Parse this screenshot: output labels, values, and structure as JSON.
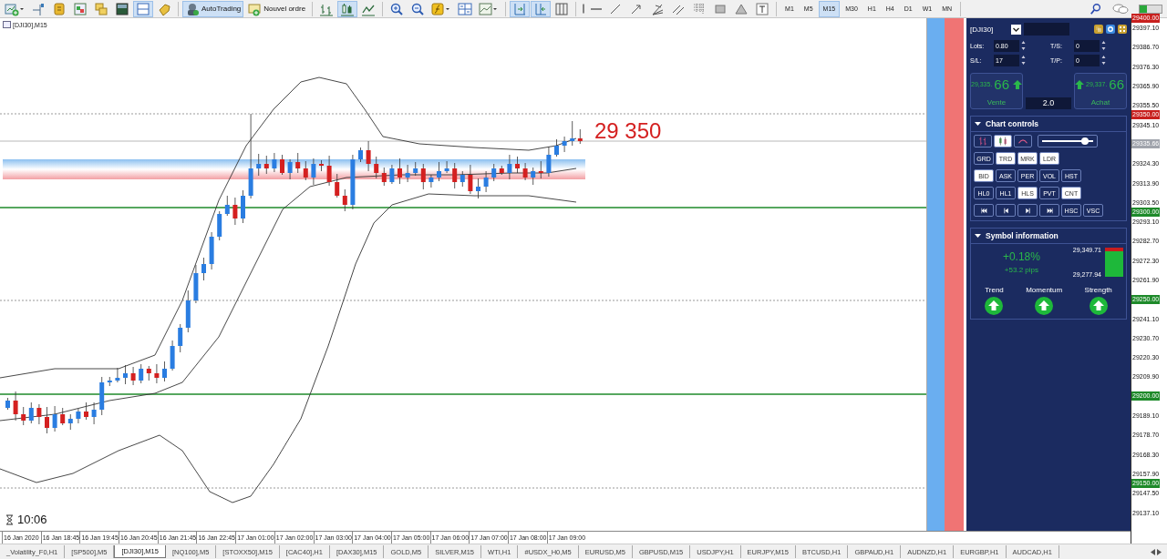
{
  "toolbar": {
    "buttons": [
      {
        "kind": "new-chart",
        "pressed": false
      },
      {
        "kind": "crosshair",
        "pressed": false
      },
      {
        "kind": "coins",
        "pressed": false
      },
      {
        "kind": "navigator",
        "pressed": false
      },
      {
        "kind": "folders",
        "pressed": false
      },
      {
        "kind": "terminal",
        "pressed": false
      },
      {
        "kind": "tester",
        "pressed": true
      },
      {
        "kind": "tag",
        "pressed": false
      },
      {
        "kind": "autotrading",
        "label": "AutoTrading",
        "pressed": true
      },
      {
        "kind": "new-order",
        "label": "Nouvel ordre",
        "pressed": false
      },
      {
        "kind": "bars",
        "pressed": false
      },
      {
        "kind": "candles",
        "pressed": true
      },
      {
        "kind": "line",
        "pressed": false
      },
      {
        "kind": "zoom-in",
        "pressed": false
      },
      {
        "kind": "zoom-out",
        "pressed": false
      },
      {
        "kind": "indicators",
        "pressed": false
      },
      {
        "kind": "tile",
        "pressed": false
      },
      {
        "kind": "template",
        "pressed": false
      },
      {
        "kind": "shift",
        "pressed": true
      },
      {
        "kind": "autoscroll",
        "pressed": true
      },
      {
        "kind": "periods",
        "pressed": false
      },
      {
        "kind": "vline",
        "pressed": false
      },
      {
        "kind": "hline",
        "pressed": false
      },
      {
        "kind": "trendline",
        "pressed": false
      },
      {
        "kind": "arrow",
        "pressed": false
      },
      {
        "kind": "fan",
        "pressed": false
      },
      {
        "kind": "channel",
        "pressed": false
      },
      {
        "kind": "grid",
        "pressed": false
      },
      {
        "kind": "rect",
        "pressed": false
      },
      {
        "kind": "triangle",
        "pressed": false
      },
      {
        "kind": "textbox",
        "pressed": false
      }
    ],
    "timeframes": [
      {
        "label": "M1",
        "selected": false
      },
      {
        "label": "M5",
        "selected": false
      },
      {
        "label": "M15",
        "selected": true
      },
      {
        "label": "M30",
        "selected": false
      },
      {
        "label": "H1",
        "selected": false
      },
      {
        "label": "H4",
        "selected": false
      },
      {
        "label": "D1",
        "selected": false
      },
      {
        "label": "W1",
        "selected": false
      },
      {
        "label": "MN",
        "selected": false
      }
    ]
  },
  "chart": {
    "title": "[DJI30],M15",
    "level_label": "29 350",
    "timer": "10:06",
    "time_labels": [
      "16 Jan 2020",
      "16 Jan 18:45",
      "16 Jan 19:45",
      "16 Jan 20:45",
      "16 Jan 21:45",
      "16 Jan 22:45",
      "17 Jan 01:00",
      "17 Jan 02:00",
      "17 Jan 03:00",
      "17 Jan 04:00",
      "17 Jan 05:00",
      "17 Jan 06:00",
      "17 Jan 07:00",
      "17 Jan 08:00",
      "17 Jan 09:00"
    ]
  },
  "price_axis": [
    {
      "kind": "overlay-tag",
      "label": "29400.00",
      "color": "#c8201e"
    },
    {
      "kind": "tick",
      "label": "29397.10"
    },
    {
      "kind": "tick",
      "label": "29386.70"
    },
    {
      "kind": "tick",
      "label": "29376.30"
    },
    {
      "kind": "tick",
      "label": "29365.90"
    },
    {
      "kind": "tick",
      "label": "29355.50"
    },
    {
      "kind": "overlay-tag",
      "label": "29350.00",
      "color": "#c8201e"
    },
    {
      "kind": "tick",
      "label": "29345.10"
    },
    {
      "kind": "tag",
      "label": "29335.66",
      "color": "#a0a4ac"
    },
    {
      "kind": "tick",
      "label": "29324.30"
    },
    {
      "kind": "tick",
      "label": "29313.90"
    },
    {
      "kind": "tick",
      "label": "29303.50"
    },
    {
      "kind": "overlay-tag",
      "label": "29300.00",
      "color": "#1e8a2a"
    },
    {
      "kind": "tick",
      "label": "29293.10"
    },
    {
      "kind": "tick",
      "label": "29282.70"
    },
    {
      "kind": "tick",
      "label": "29272.30"
    },
    {
      "kind": "tick",
      "label": "29261.90"
    },
    {
      "kind": "tag",
      "label": "29250.00",
      "color": "#1e8a2a"
    },
    {
      "kind": "tick",
      "label": "29241.10"
    },
    {
      "kind": "tick",
      "label": "29230.70"
    },
    {
      "kind": "tick",
      "label": "29220.30"
    },
    {
      "kind": "tick",
      "label": "29209.90"
    },
    {
      "kind": "tag",
      "label": "29200.00",
      "color": "#1e8a2a"
    },
    {
      "kind": "tick",
      "label": "29189.10"
    },
    {
      "kind": "tick",
      "label": "29178.70"
    },
    {
      "kind": "tick",
      "label": "29168.30"
    },
    {
      "kind": "tick",
      "label": "29157.90"
    },
    {
      "kind": "overlay-tag",
      "label": "29150.00",
      "color": "#1e8a2a"
    },
    {
      "kind": "tick",
      "label": "29147.50"
    },
    {
      "kind": "tick",
      "label": "29137.10"
    }
  ],
  "panel": {
    "symbol": "[DJI30]",
    "fields": [
      {
        "label": "Lots:",
        "value": "0.80"
      },
      {
        "label": "T/S:",
        "value": "0"
      },
      {
        "label": "S/L:",
        "value": "17"
      },
      {
        "label": "T/P:",
        "value": "0"
      }
    ],
    "sell": {
      "price": "29,335.",
      "pips": "66",
      "label": "Vente"
    },
    "volume": "2.0",
    "buy": {
      "price": "29,337.",
      "pips": "66",
      "label": "Achat"
    },
    "chart_controls": {
      "title": "Chart controls",
      "expanded": true,
      "style_buttons": [
        {
          "kind": "bars",
          "on": false
        },
        {
          "kind": "candles",
          "on": true
        },
        {
          "kind": "line",
          "on": false
        }
      ],
      "slider": {
        "level": 0.8
      },
      "rows": [
        [
          {
            "kind": "text",
            "label": "GRD",
            "on": false
          },
          {
            "kind": "text",
            "label": "TRD",
            "on": true
          },
          {
            "kind": "text",
            "label": "MRK",
            "on": true
          },
          {
            "kind": "text",
            "label": "LDR",
            "on": true
          }
        ],
        [
          {
            "kind": "text",
            "label": "BID",
            "on": true
          },
          {
            "kind": "text",
            "label": "ASK",
            "on": false
          },
          {
            "kind": "text",
            "label": "PER",
            "on": false
          },
          {
            "kind": "text",
            "label": "VOL",
            "on": false
          },
          {
            "kind": "text",
            "label": "HST",
            "on": false
          }
        ],
        [
          {
            "kind": "text",
            "label": "HL0",
            "on": false
          },
          {
            "kind": "text",
            "label": "HL1",
            "on": false
          },
          {
            "kind": "text",
            "label": "HLS",
            "on": true
          },
          {
            "kind": "text",
            "label": "PVT",
            "on": false
          },
          {
            "kind": "text",
            "label": "CNT",
            "on": true
          }
        ],
        [
          {
            "kind": "first",
            "on": false
          },
          {
            "kind": "prev",
            "on": false
          },
          {
            "kind": "next",
            "on": false
          },
          {
            "kind": "last",
            "on": false
          },
          {
            "kind": "text",
            "label": "HSC",
            "on": false
          },
          {
            "kind": "text",
            "label": "VSC",
            "on": false
          }
        ]
      ]
    },
    "symbol_info": {
      "title": "Symbol information",
      "expanded": true,
      "change": "+0.18%",
      "pips": "+53.2 pips",
      "high": "29,349.71",
      "low": "29,277.94",
      "range": {
        "level": 0.88
      },
      "indicators": [
        {
          "label": "Trend",
          "kind": "up"
        },
        {
          "label": "Momentum",
          "kind": "up"
        },
        {
          "label": "Strength",
          "kind": "up"
        }
      ]
    }
  },
  "tabs": [
    {
      "label": "_Volatility_F0,H1",
      "selected": false
    },
    {
      "label": "[SP500],M5",
      "selected": false
    },
    {
      "label": "[DJI30],M15",
      "selected": true
    },
    {
      "label": "[NQ100],M5",
      "selected": false
    },
    {
      "label": "[STOXX50],M15",
      "selected": false
    },
    {
      "label": "[CAC40],H1",
      "selected": false
    },
    {
      "label": "[DAX30],M15",
      "selected": false
    },
    {
      "label": "GOLD,M5",
      "selected": false
    },
    {
      "label": "SILVER,M15",
      "selected": false
    },
    {
      "label": "WTI,H1",
      "selected": false
    },
    {
      "label": "#USDX_H0,M5",
      "selected": false
    },
    {
      "label": "EURUSD,M5",
      "selected": false
    },
    {
      "label": "GBPUSD,M15",
      "selected": false
    },
    {
      "label": "USDJPY,H1",
      "selected": false
    },
    {
      "label": "EURJPY,M15",
      "selected": false
    },
    {
      "label": "BTCUSD,H1",
      "selected": false
    },
    {
      "label": "GBPAUD,H1",
      "selected": false
    },
    {
      "label": "AUDNZD,H1",
      "selected": false
    },
    {
      "label": "EURGBP,H1",
      "selected": false
    },
    {
      "label": "AUDCAD,H1",
      "selected": false
    }
  ]
}
